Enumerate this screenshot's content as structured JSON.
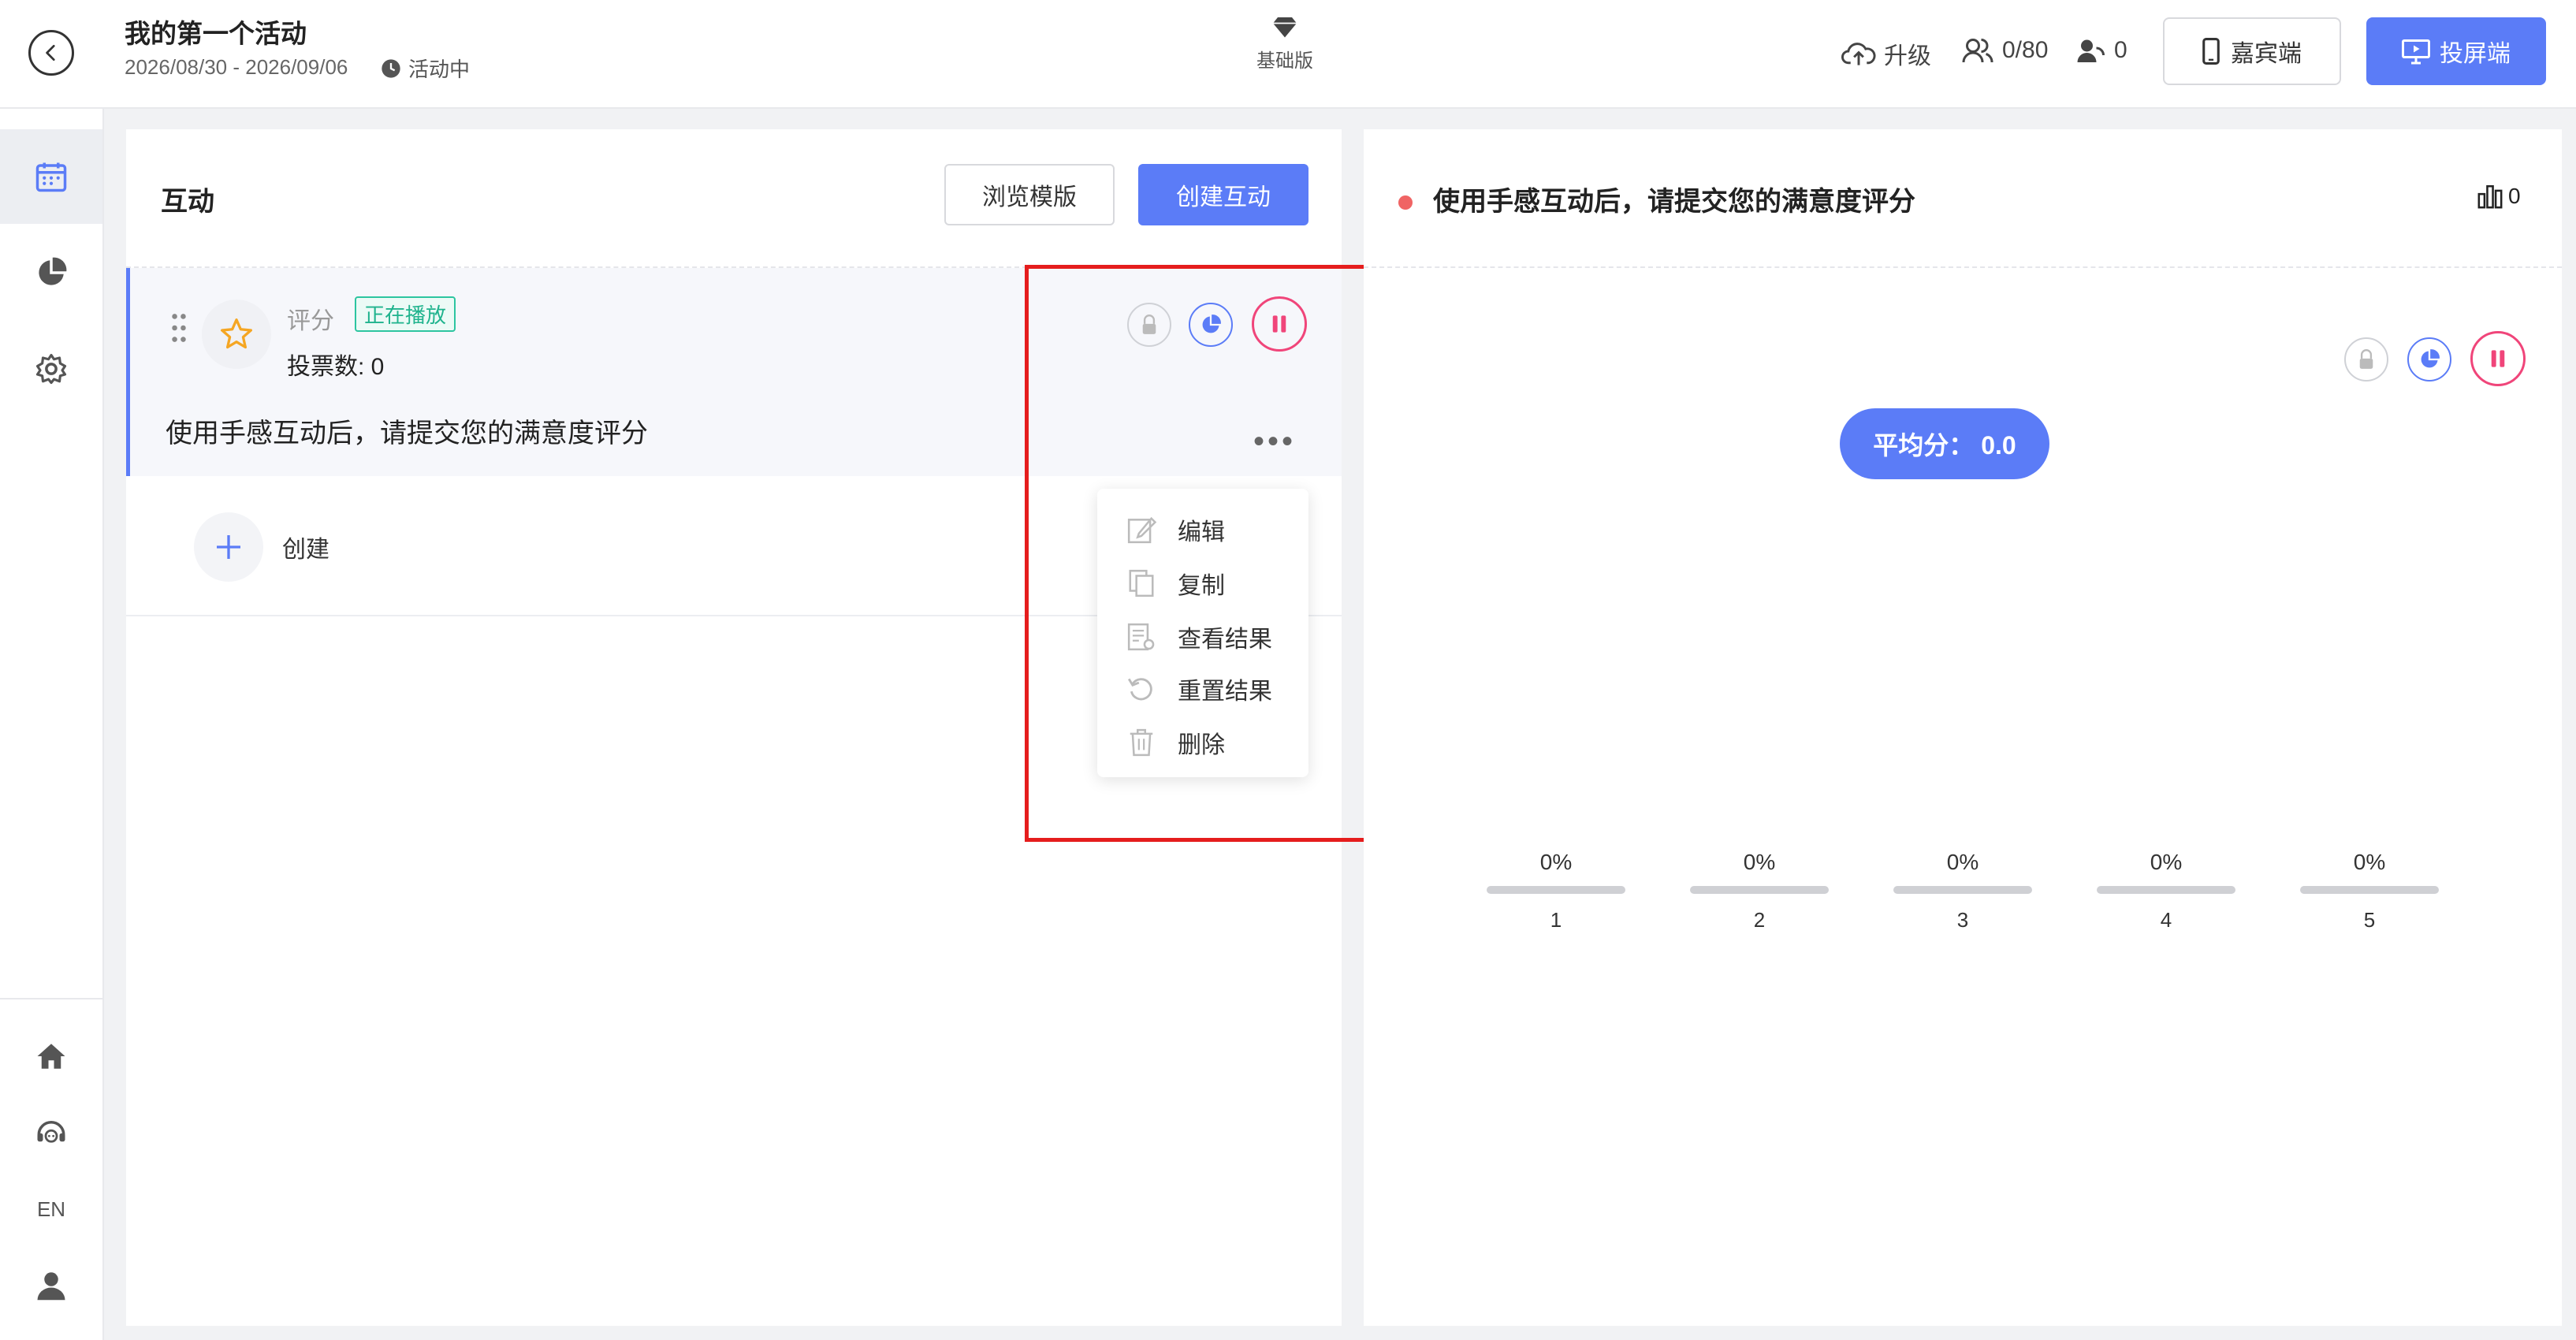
{
  "header": {
    "title": "我的第一个活动",
    "date_range": "2026/08/30 - 2026/09/06",
    "status": "活动中",
    "plan": "基础版",
    "upgrade": "升级",
    "participants": "0/80",
    "online": "0",
    "guest_button": "嘉宾端",
    "screen_button": "投屏端"
  },
  "sidebar": {
    "lang": "EN"
  },
  "left_panel": {
    "title": "互动",
    "browse_button": "浏览模版",
    "create_button": "创建互动",
    "item": {
      "type": "评分",
      "badge": "正在播放",
      "votes": "投票数: 0",
      "question": "使用手感互动后，请提交您的满意度评分",
      "more": "•••"
    },
    "create_label": "创建",
    "menu": [
      "编辑",
      "复制",
      "查看结果",
      "重置结果",
      "删除"
    ]
  },
  "right_panel": {
    "title": "使用手感互动后，请提交您的满意度评分",
    "count": "0",
    "avg_label": "平均分： 0.0"
  },
  "chart_data": {
    "type": "bar",
    "categories": [
      "1",
      "2",
      "3",
      "4",
      "5"
    ],
    "values": [
      0,
      0,
      0,
      0,
      0
    ],
    "labels": [
      "0%",
      "0%",
      "0%",
      "0%",
      "0%"
    ],
    "ylim": [
      0,
      100
    ]
  },
  "colors": {
    "accent": "#5b7cf7",
    "live": "#1fb38d",
    "pause": "#f0457a",
    "highlight": "#e51d1d"
  }
}
